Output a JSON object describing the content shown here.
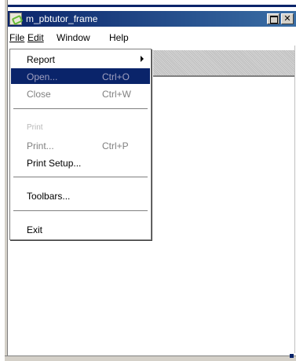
{
  "window": {
    "title": "m_pbtutor_frame",
    "restore_glyph": "",
    "close_glyph": "✕"
  },
  "menubar": {
    "items": [
      {
        "label": "File",
        "accel": "F"
      },
      {
        "label": "Edit",
        "accel": "E"
      },
      {
        "label": "Window",
        "accel": "W"
      },
      {
        "label": "Help",
        "accel": "H"
      }
    ]
  },
  "file_menu": {
    "items": [
      {
        "label": "Report",
        "shortcut": "",
        "state": "enabled",
        "submenu": true
      },
      {
        "label": "Open...",
        "shortcut": "Ctrl+O",
        "state": "highlighted-disabled"
      },
      {
        "label": "Close",
        "shortcut": "Ctrl+W",
        "state": "disabled"
      },
      {
        "label": "Print",
        "shortcut": "",
        "state": "ghost"
      },
      {
        "label": "Print...",
        "shortcut": "Ctrl+P",
        "state": "disabled"
      },
      {
        "label": "Print Setup...",
        "shortcut": "",
        "state": "enabled"
      },
      {
        "label": "Toolbars...",
        "shortcut": "",
        "state": "enabled"
      },
      {
        "label": "Exit",
        "shortcut": "",
        "state": "enabled"
      }
    ]
  },
  "colors": {
    "title_bar": "#0a246a",
    "highlight": "#0a246a",
    "disabled_text": "#808080",
    "face": "#d4d0c8"
  },
  "icons": {
    "app": "pb-app-icon",
    "submenu": "submenu-arrow-icon",
    "restore": "restore-icon",
    "close": "close-icon"
  }
}
